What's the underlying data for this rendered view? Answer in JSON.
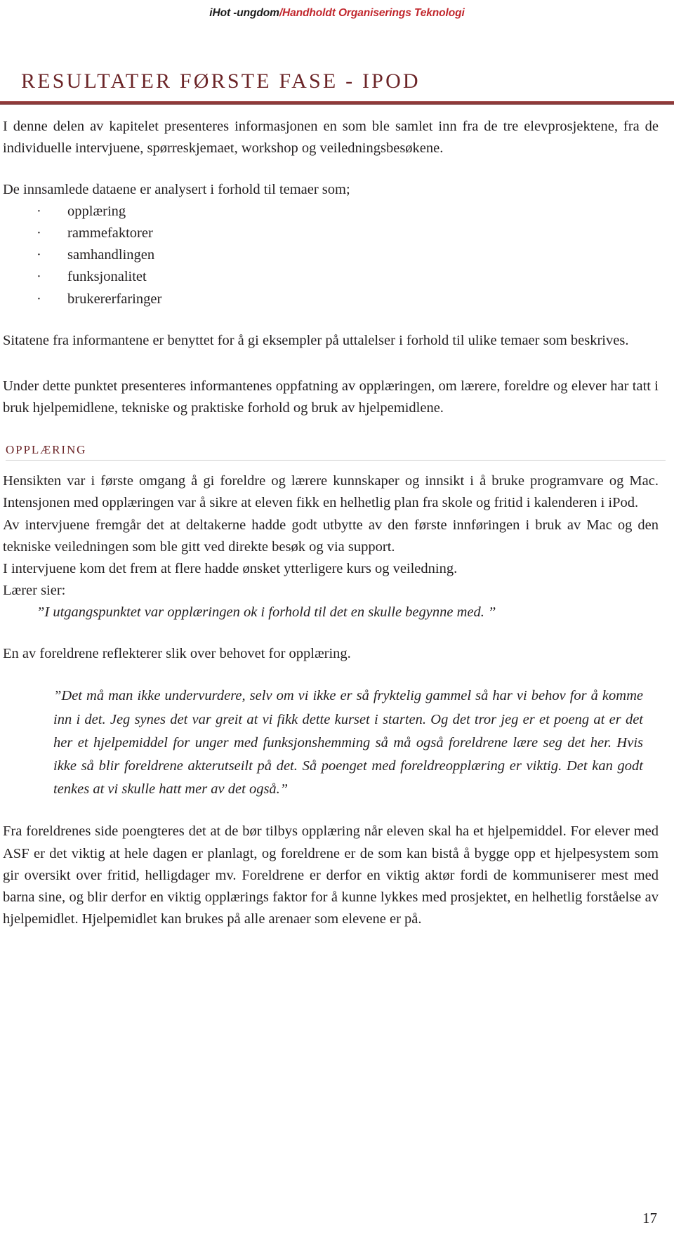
{
  "header": {
    "brand_black": "iHot -ungdom",
    "brand_red": "/Handholdt Organiserings Teknologi",
    "brand_red_color": "#c1272d"
  },
  "title": {
    "text": "RESULTATER FØRSTE FASE - IPOD",
    "color": "#6b2427",
    "rule_color": "#8c3a3a"
  },
  "body": {
    "intro": "I denne delen av kapitelet presenteres informasjonen en som ble samlet inn fra de tre elevprosjektene, fra de individuelle intervjuene, spørreskjemaet, workshop og veiledningsbesøkene.",
    "themes_lead": "De innsamlede dataene er analysert i forhold til temaer som;",
    "themes": [
      "opplæring",
      "rammefaktorer",
      "samhandlingen",
      "funksjonalitet",
      "brukererfaringer"
    ],
    "bullet_glyph": "·",
    "quotes_note": "Sitatene fra informantene er benyttet for å gi eksempler på uttalelser i forhold til ulike temaer som beskrives.",
    "under_point": "Under dette punktet presenteres informantenes oppfatning av opplæringen, om lærere, foreldre og elever har tatt i bruk hjelpemidlene, tekniske og praktiske forhold og bruk av hjelpemidlene."
  },
  "section": {
    "heading": "OPPLÆRING",
    "heading_color": "#6b2427",
    "para_1": "Hensikten var i første omgang å gi foreldre og lærere kunnskaper og innsikt i å bruke programvare og Mac. Intensjonen med opplæringen var å sikre at eleven fikk en helhetlig plan fra skole og fritid i kalenderen i iPod.",
    "para_2": "Av intervjuene fremgår det at deltakerne hadde godt utbytte av den første innføringen i bruk av Mac og den tekniske veiledningen som ble gitt ved direkte besøk og via support.",
    "para_3": "I intervjuene kom det frem at flere hadde ønsket ytterligere kurs og veiledning.",
    "teacher_lead": "Lærer sier:",
    "teacher_quote": "”I utgangspunktet var opplæringen ok i forhold til det en skulle begynne med. ”",
    "parent_lead": "En av foreldrene reflekterer slik over behovet for opplæring.",
    "parent_quote": "”Det må man ikke undervurdere, selv om vi ikke er så fryktelig gammel så har vi behov for å komme inn i det. Jeg synes det var greit at vi fikk dette kurset i starten. Og det tror jeg er et poeng at er det her et hjelpemiddel for unger med funksjonshemming så må også foreldrene lære seg det her. Hvis ikke så blir foreldrene akterutseilt på det. Så poenget med foreldreopplæring er viktig. Det kan godt tenkes at vi skulle hatt mer av det også.”",
    "para_4": "Fra foreldrenes side poengteres det at de bør tilbys opplæring når eleven skal ha et hjelpemiddel. For elever med ASF er det viktig at hele dagen er planlagt, og foreldrene er de som kan bistå å bygge opp et hjelpesystem som gir oversikt over fritid, helligdager mv. Foreldrene er derfor en viktig aktør fordi de kommuniserer mest med barna sine, og blir derfor en viktig opplærings faktor for å kunne lykkes med prosjektet, en helhetlig forståelse av hjelpemidlet. Hjelpemidlet kan brukes på alle arenaer som elevene er på."
  },
  "footer": {
    "page_number": "17"
  }
}
